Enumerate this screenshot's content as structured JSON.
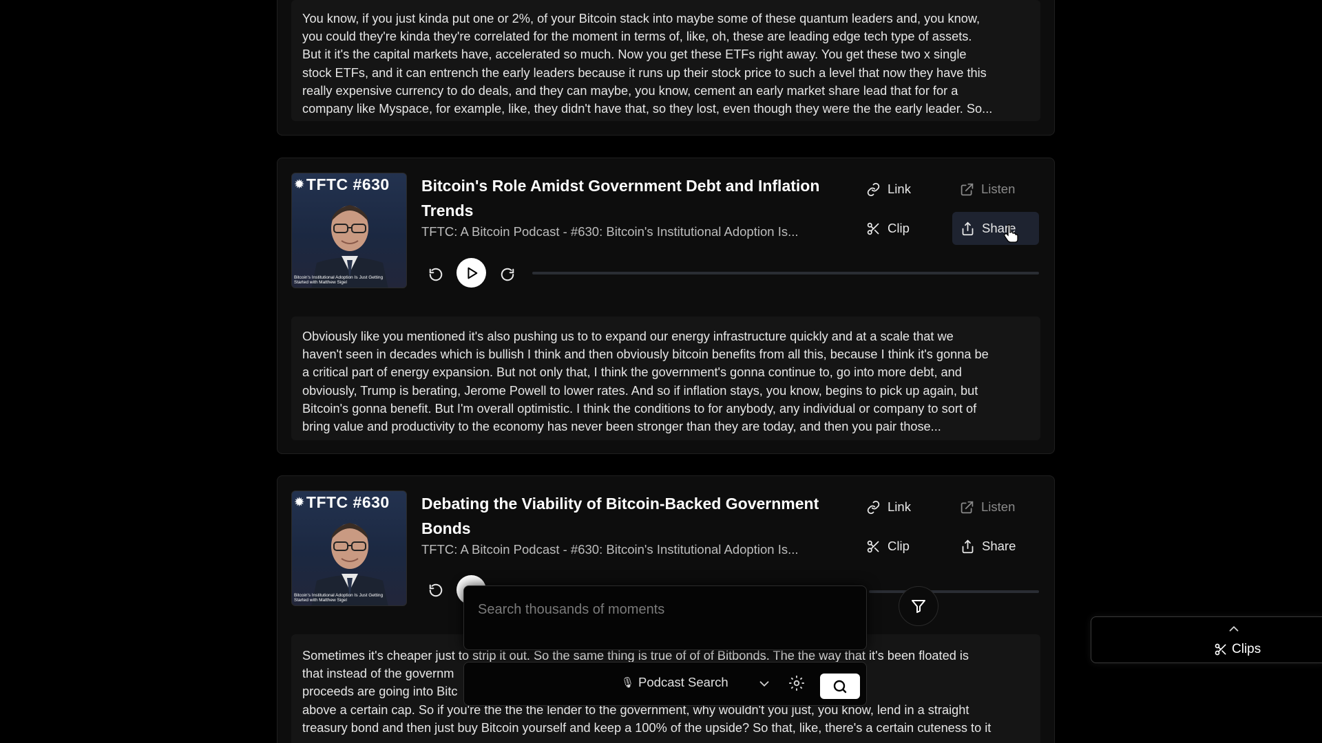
{
  "excerpts": {
    "first": [
      "You know, if you just kinda put one or 2%, of your Bitcoin stack into maybe some of these quantum leaders and, you know,",
      "you could they're kinda they're correlated for the moment in terms of, like, oh, these are leading edge tech type of assets.",
      "But it it's the capital markets have, accelerated so much. Now you get these ETFs right away. You get these two x single",
      "stock ETFs, and it can entrench the early leaders because it runs up their stock price to such a level that now they have this",
      "really expensive currency to do deals, and they can maybe, you know, cement an early market share lead that for for a",
      "company like Myspace, for example, like, they didn't have that, so they lost, even though they were the the early leader. So..."
    ],
    "second": [
      "Obviously like you mentioned it's also pushing us to to expand our energy infrastructure quickly and at a scale that we",
      "haven't seen in decades which is bullish I think and then obviously bitcoin benefits from all this, because I think it's gonna be",
      "a critical part of energy expansion. But not only that, I think the government's gonna continue to, go into more debt, and",
      "obviously, Trump is berating, Jerome Powell to lower rates. And so if inflation stays, you know, begins to pick up again, but",
      "Bitcoin's gonna benefit. But I'm overall optimistic. I think the conditions to for anybody, any individual or company to sort of",
      "bring value and productivity to the economy has never been stronger than they are today, and then you pair those..."
    ],
    "third": [
      "Sometimes it's cheaper just to strip it out. So the same thing is true of of of Bitbonds. The the way that it's been floated is",
      "that instead of the governm                                                                   per because part of the",
      "proceeds are going into Bitc                                                                  ond has to split the upside",
      "above a certain cap. So if you're the the the lender to the government, why wouldn't you just, you know, lend in a straight",
      "treasury bond and then just buy Bitcoin yourself and keep a 100% of the upside? So that, like, there's a certain cuteness to it"
    ]
  },
  "episodes": [
    {
      "thumb_tag": "TFTC #630",
      "thumb_caption": "Bitcoin's Institutional Adoption Is Just Getting Started with Matthew Sigel",
      "title": "Bitcoin's Role Amidst Government Debt and Inflation Trends",
      "subtitle": "TFTC: A Bitcoin Podcast - #630: Bitcoin's Institutional Adoption Is..."
    },
    {
      "thumb_tag": "TFTC #630",
      "thumb_caption": "Bitcoin's Institutional Adoption Is Just Getting Started with Matthew Sigel",
      "title": "Debating the Viability of Bitcoin-Backed Government Bonds",
      "subtitle": "TFTC: A Bitcoin Podcast - #630: Bitcoin's Institutional Adoption Is..."
    }
  ],
  "actions": {
    "link": "Link",
    "listen": "Listen",
    "clip": "Clip",
    "share": "Share"
  },
  "search": {
    "placeholder": "Search thousands of moments",
    "mode_label": "Podcast Search"
  },
  "clips_panel": {
    "label": "Clips"
  }
}
